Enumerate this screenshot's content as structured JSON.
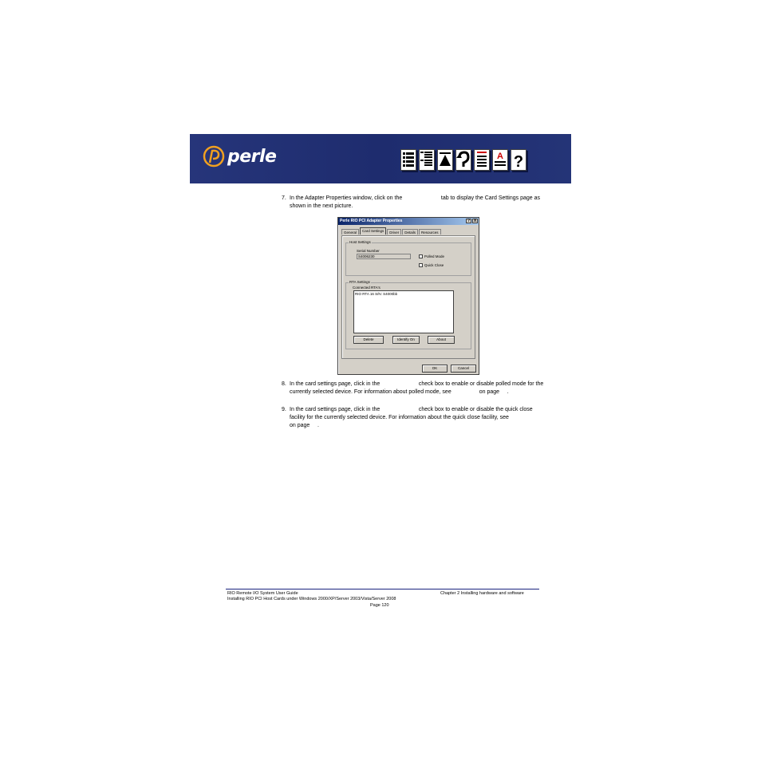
{
  "header": {
    "logo_text": "perle",
    "nav_icons": [
      "contents-icon",
      "index-icon",
      "top-icon",
      "back-icon",
      "previous-page-icon",
      "next-page-icon",
      "help-icon"
    ]
  },
  "steps": [
    {
      "num": "7.",
      "text": "In the Adapter Properties window, click on the                         tab to display the Card Settings page as shown in the next picture."
    },
    {
      "num": "8.",
      "text": "In the card settings page, click in the                         check box to enable or disable polled mode for the currently selected device. For information about polled mode, see                  on page     ."
    },
    {
      "num": "9.",
      "text": "In the card settings page, click in the                         check box to enable or disable the quick close facility for the currently selected device. For information about the quick close facility, see                                 on page     ."
    }
  ],
  "dialog": {
    "title": "Perle RIO PCI Adapter Properties",
    "help_btn": "?",
    "close_btn": "X",
    "tabs": [
      "General",
      "Card Settings",
      "Driver",
      "Details",
      "Resources"
    ],
    "host_settings": {
      "label": "Host Settings",
      "serial_label": "Serial Number",
      "serial_value": "S4006230",
      "polled_mode": "Polled Mode",
      "quick_close": "Quick Close"
    },
    "rta_settings": {
      "label": "RTA Settings",
      "connected_label": "Connected RTA's",
      "items": [
        "RIO RTA 16 S/N: S4000bb"
      ],
      "delete_btn": "Delete",
      "identify_btn": "Identify On",
      "about_btn": "About"
    },
    "ok_btn": "OK",
    "cancel_btn": "Cancel"
  },
  "footer": {
    "left_line1": "RIO Remote I/O System User Guide",
    "left_line2": "Installing RIO PCI Host Cards under Windows 2000/XP/Server 2003/Vista/Server 2008",
    "right_line1": "Chapter 2 Installing hardware and software",
    "page": "Page 120"
  }
}
